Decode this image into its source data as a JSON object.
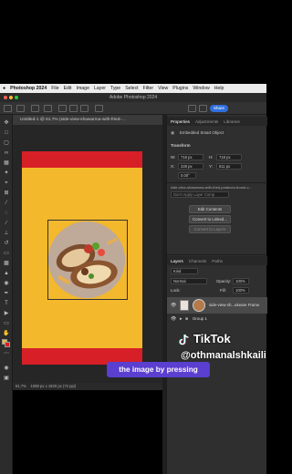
{
  "menubar": {
    "apple": "",
    "app_name": "Photoshop 2024",
    "items": [
      "File",
      "Edit",
      "Image",
      "Layer",
      "Type",
      "Select",
      "Filter",
      "View",
      "Plugins",
      "Window",
      "Help"
    ]
  },
  "window": {
    "title": "Adobe Photoshop 2024",
    "share_label": "Share"
  },
  "document": {
    "tab_title": "Untitled-1 @ 61.7% (side-view-shawarma-with-fried-...",
    "zoom_status": "61.7%",
    "doc_size": "1080 px x 1920 px (72 ppi)"
  },
  "properties": {
    "tabs": [
      "Properties",
      "Adjustments",
      "Libraries"
    ],
    "object_type": "Embedded Smart Object",
    "transform_label": "Transform",
    "w_label": "W:",
    "w_value": "718 px",
    "h_label": "H:",
    "h_value": "718 px",
    "x_label": "X:",
    "x_value": "228 px",
    "y_label": "Y:",
    "y_value": "611 px",
    "angle_value": "0.00°",
    "filename": "side-view-shawarma-with-fried-potatoes-board-c...",
    "comp_placeholder": "Don't Apply Layer Comp",
    "edit_contents": "Edit Contents",
    "convert_linked": "Convert to Linked...",
    "convert_layers": "Convert to Layers"
  },
  "layers": {
    "tabs": [
      "Layers",
      "Channels",
      "Paths"
    ],
    "kind_label": "Kind",
    "blend_mode": "Normal",
    "opacity_label": "Opacity:",
    "opacity_value": "100%",
    "lock_label": "Lock:",
    "fill_label": "Fill:",
    "fill_value": "100%",
    "items": [
      {
        "name": "side-view-sh...ukeare Frame"
      },
      {
        "name": "Group 1"
      }
    ]
  },
  "overlay": {
    "caption": "the image by pressing",
    "brand": "TikTok",
    "handle": "@othmanalshkaili"
  },
  "colors": {
    "canvas_yellow": "#f4b82c",
    "band_red": "#d61f27",
    "caption_purple": "#5a3fd0",
    "share_blue": "#2f6fdb"
  }
}
